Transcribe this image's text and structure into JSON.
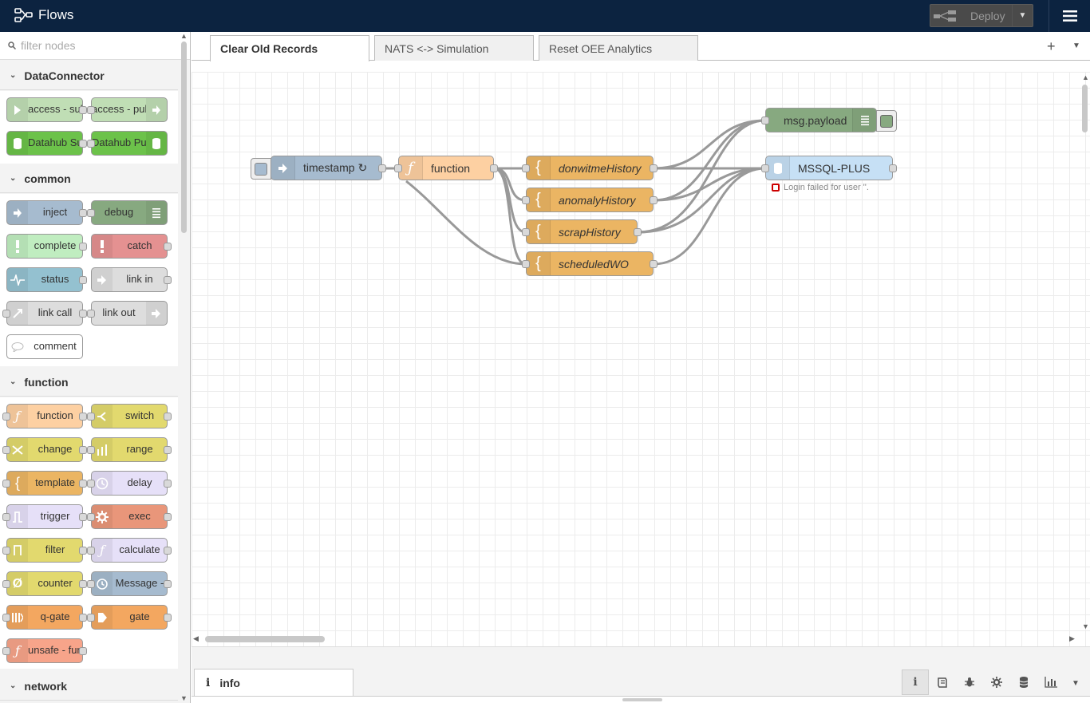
{
  "header": {
    "title": "Flows",
    "deploy_label": "Deploy"
  },
  "palette": {
    "filter_placeholder": "filter nodes",
    "categories": [
      {
        "name": "DataConnector",
        "nodes": [
          "access - subscribe",
          "access - publish",
          "Datahub Subscribe",
          "Datahub Publish"
        ]
      },
      {
        "name": "common",
        "nodes": [
          "inject",
          "debug",
          "complete",
          "catch",
          "status",
          "link in",
          "link call",
          "link out",
          "comment"
        ]
      },
      {
        "name": "function",
        "nodes": [
          "function",
          "switch",
          "change",
          "range",
          "template",
          "delay",
          "trigger",
          "exec",
          "filter",
          "calculate",
          "counter",
          "Message - ",
          "q-gate",
          "gate",
          "unsafe - function"
        ]
      },
      {
        "name": "network",
        "nodes": []
      }
    ]
  },
  "tabs": [
    {
      "label": "Clear Old Records",
      "active": true
    },
    {
      "label": "NATS <-> Simulation",
      "active": false
    },
    {
      "label": "Reset OEE Analytics",
      "active": false
    }
  ],
  "flow": {
    "nodes": {
      "timestamp": "timestamp ↻",
      "function": "function",
      "donwitme": "donwitmeHistory",
      "anomaly": "anomalyHistory",
      "scrap": "scrapHistory",
      "scheduled": "scheduledWO",
      "debug": "msg.payload",
      "mssql": "MSSQL-PLUS"
    },
    "mssql_status": "Login failed for user ''."
  },
  "bottom": {
    "info_tab": "info"
  },
  "colors": {
    "header_bg": "#0c2340",
    "inject": "#a6bbcf",
    "debug": "#87a980",
    "function": "#fdd0a2",
    "template": "#ebb563",
    "mssql": "#c6e0f5",
    "error": "#cc0000"
  }
}
